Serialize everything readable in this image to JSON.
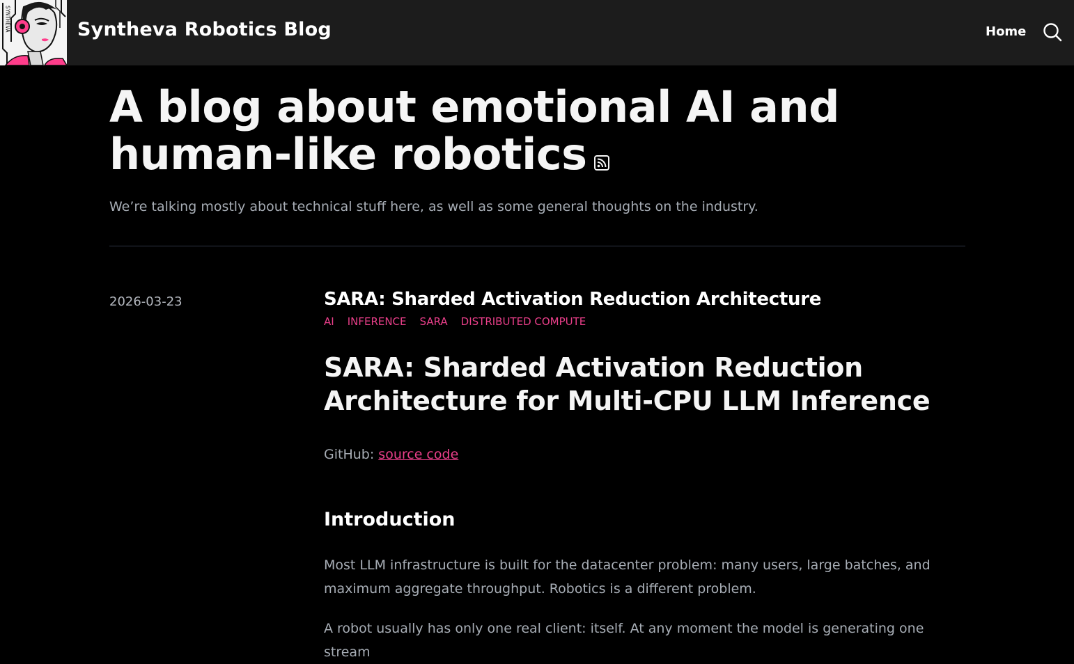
{
  "header": {
    "logo_text": "SYNTHEVA",
    "site_title": "Syntheva Robotics Blog",
    "nav": [
      {
        "label": "Home"
      }
    ],
    "search_icon": "search-icon"
  },
  "hero": {
    "title": "A blog about emotional AI and human-like robotics",
    "rss_icon": "rss-icon",
    "subtitle": "We’re talking mostly about technical stuff here, as well as some general thoughts on the industry."
  },
  "post": {
    "date": "2026-03-23",
    "title": "SARA: Sharded Activation Reduction Architecture",
    "tags": [
      "AI",
      "INFERENCE",
      "SARA",
      "DISTRIBUTED COMPUTE"
    ],
    "heading": "SARA: Sharded Activation Reduction Architecture for Multi-CPU LLM Inference",
    "github_label": "GitHub: ",
    "github_link_text": "source code",
    "section_title": "Introduction",
    "paragraphs": [
      "Most LLM infrastructure is built for the datacenter problem: many users, large batches, and maximum aggregate throughput. Robotics is a different problem.",
      "A robot usually has only one real client: itself. At any moment the model is generating one stream"
    ]
  },
  "colors": {
    "background": "#000000",
    "topbar": "#1c1c1c",
    "accent": "#ea3f8a",
    "muted_text": "#a7adb5",
    "divider": "#2f3646"
  }
}
